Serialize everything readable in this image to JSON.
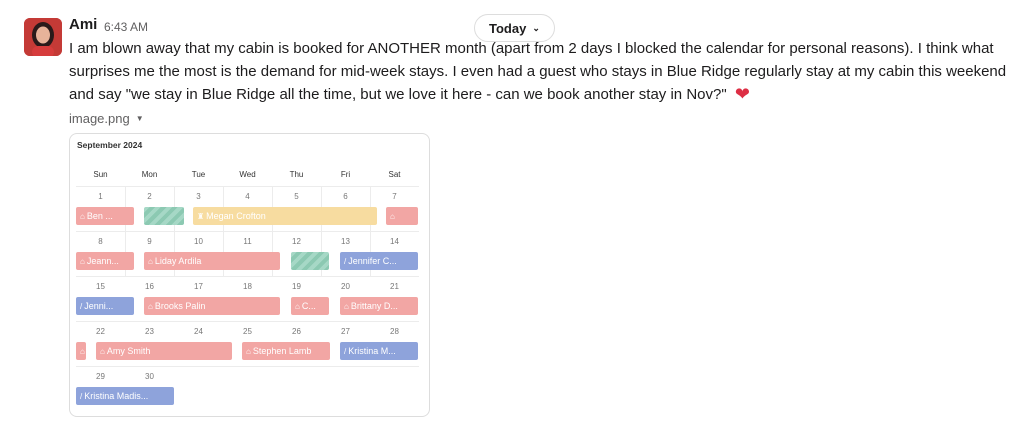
{
  "author": "Ami",
  "time": "6:43 AM",
  "today_label": "Today",
  "message": "I am blown away that my cabin is booked for ANOTHER month (apart from 2 days I blocked the calendar for personal reasons).  I think what surprises me the most is the demand for mid-week stays.  I even had a guest who stays in Blue Ridge regularly stay at my cabin this weekend and say \"we stay in Blue Ridge all the time, but we love it here - can we book another stay in Nov?\"",
  "reaction_emoji": "❤",
  "file_name": "image.png",
  "calendar": {
    "title": "September 2024",
    "weekdays": [
      "Sun",
      "Mon",
      "Tue",
      "Wed",
      "Thu",
      "Fri",
      "Sat"
    ],
    "weeks": [
      [
        "1",
        "2",
        "3",
        "4",
        "5",
        "6",
        "7"
      ],
      [
        "8",
        "9",
        "10",
        "11",
        "12",
        "13",
        "14"
      ],
      [
        "15",
        "16",
        "17",
        "18",
        "19",
        "20",
        "21"
      ],
      [
        "22",
        "23",
        "24",
        "25",
        "26",
        "27",
        "28"
      ],
      [
        "29",
        "30",
        "",
        "",
        "",
        "",
        ""
      ]
    ],
    "bookings": [
      {
        "label": "Ben ...",
        "color": "red",
        "icon": "airbnb"
      },
      {
        "label": "",
        "color": "green",
        "icon": "blocked"
      },
      {
        "label": "Megan Crofton",
        "color": "yellow",
        "icon": "direct"
      },
      {
        "label": "",
        "color": "red",
        "icon": "airbnb"
      },
      {
        "label": "Jeann...",
        "color": "red",
        "icon": "airbnb"
      },
      {
        "label": "Liday Ardila",
        "color": "red",
        "icon": "airbnb"
      },
      {
        "label": "",
        "color": "green",
        "icon": "blocked"
      },
      {
        "label": "Jennifer C...",
        "color": "blue",
        "icon": "vrbo"
      },
      {
        "label": "Jenni...",
        "color": "blue",
        "icon": "vrbo"
      },
      {
        "label": "Brooks Palin",
        "color": "red",
        "icon": "airbnb"
      },
      {
        "label": "C...",
        "color": "red",
        "icon": "airbnb"
      },
      {
        "label": "Brittany D...",
        "color": "red",
        "icon": "airbnb"
      },
      {
        "label": "",
        "color": "red",
        "icon": "airbnb"
      },
      {
        "label": "Amy Smith",
        "color": "red",
        "icon": "airbnb"
      },
      {
        "label": "Stephen Lamb",
        "color": "red",
        "icon": "airbnb"
      },
      {
        "label": "Kristina M...",
        "color": "blue",
        "icon": "vrbo"
      },
      {
        "label": "Kristina Madis...",
        "color": "blue",
        "icon": "vrbo"
      }
    ]
  },
  "colors": {
    "red": "#f2a6a4",
    "yellow": "#f7dca0",
    "blue": "#8ea3db",
    "green": "#a6d8c6",
    "avatar": "#b4302f"
  }
}
